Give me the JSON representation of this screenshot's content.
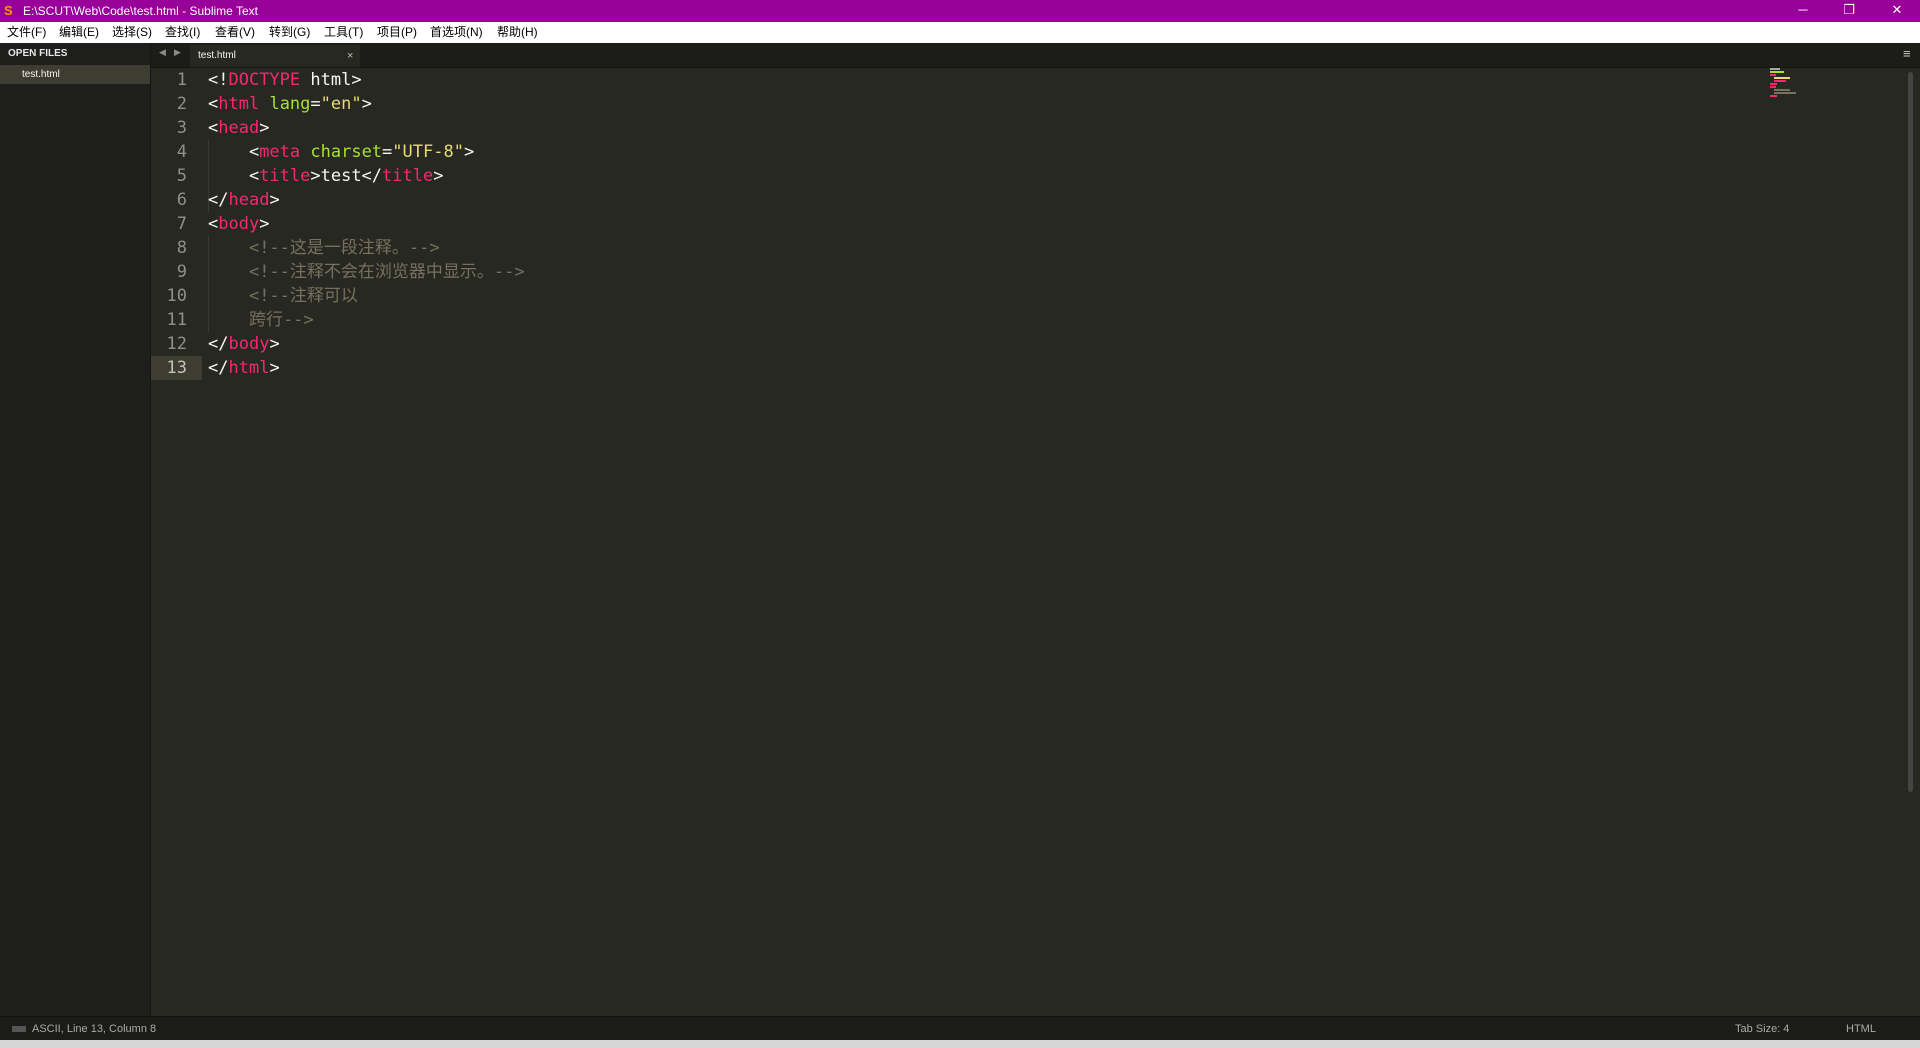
{
  "window": {
    "title": "E:\\SCUT\\Web\\Code\\test.html - Sublime Text",
    "app_icon": "sublime-text-icon",
    "controls": {
      "minimize": "─",
      "maximize": "❐",
      "close": "✕"
    }
  },
  "menu": [
    "文件(F)",
    "编辑(E)",
    "选择(S)",
    "查找(I)",
    "查看(V)",
    "转到(G)",
    "工具(T)",
    "项目(P)",
    "首选项(N)",
    "帮助(H)"
  ],
  "sidebar": {
    "header": "OPEN FILES",
    "files": [
      "test.html"
    ]
  },
  "tabs": {
    "nav_left": "◀",
    "nav_right": "▶",
    "items": [
      {
        "label": "test.html",
        "close": "×"
      }
    ],
    "menu_icon": "≡"
  },
  "editor": {
    "active_line": 13,
    "lines": [
      [
        {
          "t": "<!"
        },
        {
          "t": "DOCTYPE",
          "c": "tg"
        },
        {
          "t": " html>"
        }
      ],
      [
        {
          "t": "<"
        },
        {
          "t": "html",
          "c": "tg"
        },
        {
          "t": " "
        },
        {
          "t": "lang",
          "c": "at"
        },
        {
          "t": "="
        },
        {
          "t": "\"en\"",
          "c": "st"
        },
        {
          "t": ">"
        }
      ],
      [
        {
          "t": "<"
        },
        {
          "t": "head",
          "c": "tg"
        },
        {
          "t": ">"
        }
      ],
      [
        {
          "t": "    <"
        },
        {
          "t": "meta",
          "c": "tg"
        },
        {
          "t": " "
        },
        {
          "t": "charset",
          "c": "at"
        },
        {
          "t": "="
        },
        {
          "t": "\"UTF-8\"",
          "c": "st"
        },
        {
          "t": ">"
        }
      ],
      [
        {
          "t": "    <"
        },
        {
          "t": "title",
          "c": "tg"
        },
        {
          "t": ">test</"
        },
        {
          "t": "title",
          "c": "tg"
        },
        {
          "t": ">"
        }
      ],
      [
        {
          "t": "</"
        },
        {
          "t": "head",
          "c": "tg"
        },
        {
          "t": ">"
        }
      ],
      [
        {
          "t": "<"
        },
        {
          "t": "body",
          "c": "tg"
        },
        {
          "t": ">"
        }
      ],
      [
        {
          "t": "    "
        },
        {
          "t": "<!--这是一段注释。-->",
          "c": "cm"
        }
      ],
      [
        {
          "t": "    "
        },
        {
          "t": "<!--注释不会在浏览器中显示。-->",
          "c": "cm"
        }
      ],
      [
        {
          "t": "    "
        },
        {
          "t": "<!--注释可以",
          "c": "cm"
        }
      ],
      [
        {
          "t": "    "
        },
        {
          "t": "跨行-->",
          "c": "cm"
        }
      ],
      [
        {
          "t": "</"
        },
        {
          "t": "body",
          "c": "tg"
        },
        {
          "t": ">"
        }
      ],
      [
        {
          "t": "</"
        },
        {
          "t": "html",
          "c": "tg"
        },
        {
          "t": ">"
        }
      ]
    ]
  },
  "status": {
    "position": "ASCII, Line 13, Column 8",
    "tab_size": "Tab Size: 4",
    "syntax": "HTML"
  },
  "colors": {
    "title_bar": "#990099",
    "editor_bg": "#272822",
    "tag": "#f92672",
    "attribute": "#a6e22e",
    "string": "#e6db74",
    "comment": "#75715e"
  }
}
